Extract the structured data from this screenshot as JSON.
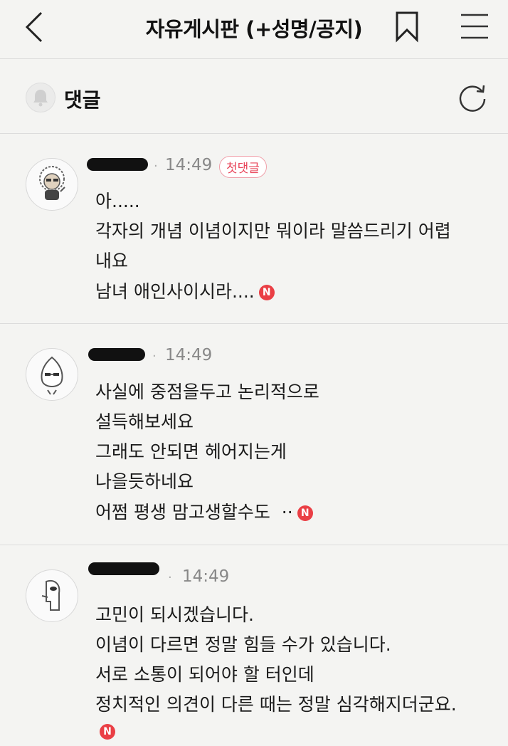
{
  "header": {
    "title": "자유게시판 (+성명/공지)"
  },
  "comments_section": {
    "title": "댓글"
  },
  "comments": [
    {
      "time": "14:49",
      "badge": "첫댓글",
      "lines": [
        "아.....",
        "각자의 개념 이념이지만 뭐이라 말씀드리기 어렵",
        "내요",
        "남녀 애인사이시라...."
      ],
      "new_mark": "N"
    },
    {
      "time": "14:49",
      "lines": [
        "사실에 중점을두고 논리적으로",
        "설득해보세요",
        "그래도 안되면 헤어지는게",
        "나을듯하네요",
        "어쩜 평생 맘고생할수도  ··"
      ],
      "new_mark": "N"
    },
    {
      "time": "14:49",
      "lines": [
        "고민이 되시겠습니다.",
        "이념이 다르면 정말 힘들 수가 있습니다.",
        "서로 소통이 되어야 할 터인데",
        "정치적인 의견이 다른 때는 정말 심각해지더군요."
      ],
      "new_mark": "N"
    }
  ],
  "colors": {
    "background": "#f4f4f2",
    "new_badge": "#ea3f45",
    "first_comment_badge": "#e8455a",
    "redaction": "#111111"
  },
  "icons": [
    "back-arrow-icon",
    "bookmark-icon",
    "menu-icon",
    "bell-icon",
    "refresh-icon"
  ]
}
